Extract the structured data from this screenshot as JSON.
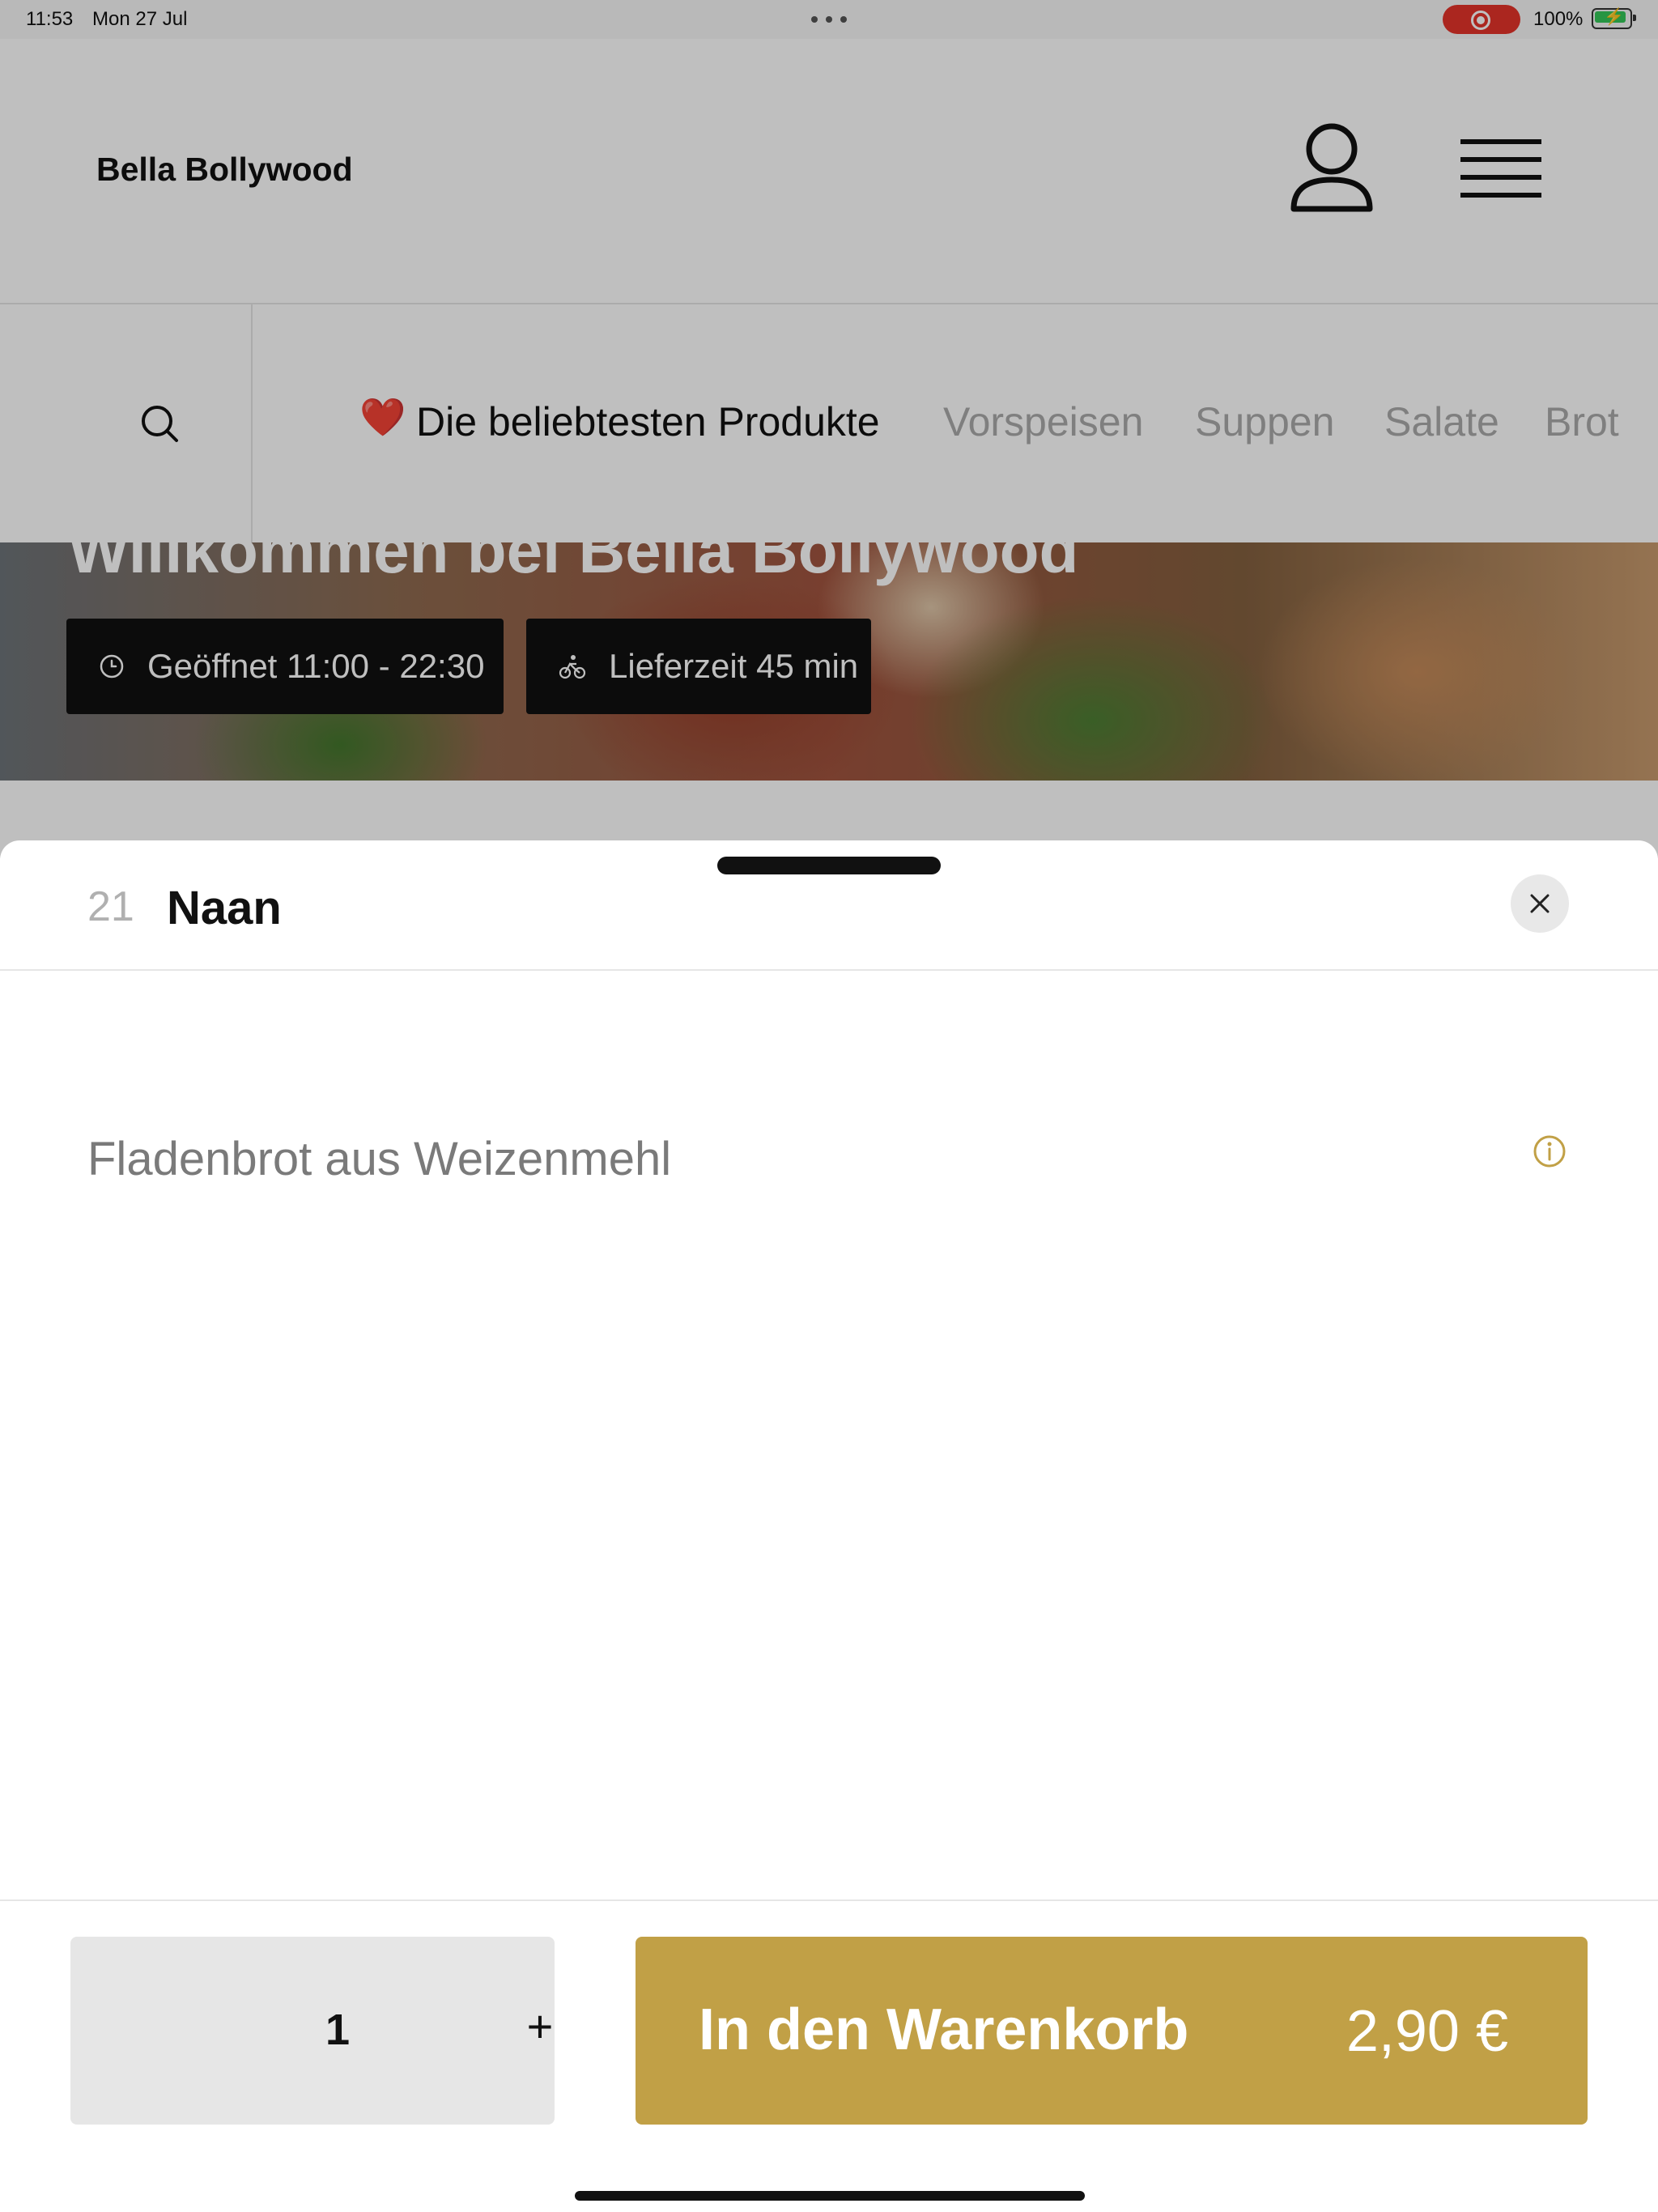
{
  "status_bar": {
    "time": "11:53",
    "date": "Mon 27 Jul",
    "battery": "100%",
    "battery_level": 1.0,
    "recording_color": "#e5332a"
  },
  "header": {
    "brand": "Bella Bollywood",
    "user_icon": "user-icon",
    "menu_icon": "hamburger-menu-icon"
  },
  "categories": {
    "search_icon": "search-icon",
    "heart": "❤️",
    "items": [
      "Die beliebtesten Produkte",
      "Vorspeisen",
      "Suppen",
      "Salate",
      "Brot"
    ],
    "active_index": 0
  },
  "hero": {
    "title": "Willkommen bei Bella Bollywood",
    "open_hours": "Geöffnet 11:00 - 22:30",
    "delivery_time": "Lieferzeit 45 min"
  },
  "sheet": {
    "product_number": "21",
    "product_name": "Naan",
    "description": "Fladenbrot aus Weizenmehl",
    "close_icon": "close-icon",
    "info_icon": "info-icon"
  },
  "footer": {
    "quantity": "1",
    "plus": "+",
    "add_label": "In den Warenkorb",
    "price": "2,90 €",
    "accent_color": "#c1a046"
  }
}
